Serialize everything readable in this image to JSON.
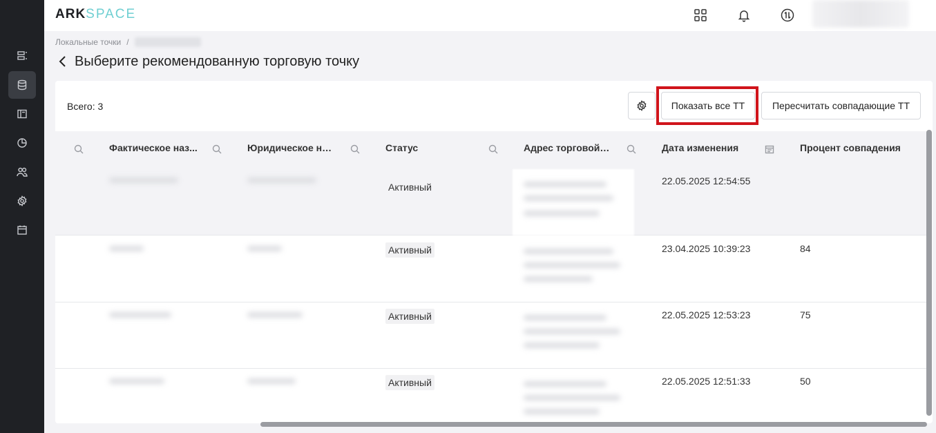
{
  "app": {
    "logo_part1": "ARK",
    "logo_part2": "SPACE"
  },
  "breadcrumb": {
    "item1": "Локальные точки",
    "separator": "/"
  },
  "page": {
    "title": "Выберите рекомендованную торговую точку"
  },
  "toolbar": {
    "total": "Всего: 3",
    "show_all_label": "Показать все ТТ",
    "recalc_label": "Пересчитать совпадающие ТТ"
  },
  "table": {
    "columns": [
      "Фактическое наз...",
      "Юридическое наз...",
      "Статус",
      "Адрес торговой т...",
      "Дата изменения",
      "Процент совпадения"
    ],
    "rows": [
      {
        "status": "Активный",
        "date": "22.05.2025 12:54:55",
        "percent": ""
      },
      {
        "status": "Активный",
        "date": "23.04.2025 10:39:23",
        "percent": "84"
      },
      {
        "status": "Активный",
        "date": "22.05.2025 12:53:23",
        "percent": "75"
      },
      {
        "status": "Активный",
        "date": "22.05.2025 12:51:33",
        "percent": "50"
      }
    ]
  },
  "icons": {
    "sidebar": [
      "list-icon",
      "database-icon",
      "layout-icon",
      "chart-icon",
      "users-icon",
      "gear-icon",
      "calendar-icon"
    ],
    "header": [
      "apps-grid-icon",
      "bell-icon",
      "sync-icon"
    ]
  },
  "colors": {
    "sidebar_bg": "#1f2125",
    "logo_accent": "#6fcfd2",
    "highlight": "#d0141b"
  }
}
